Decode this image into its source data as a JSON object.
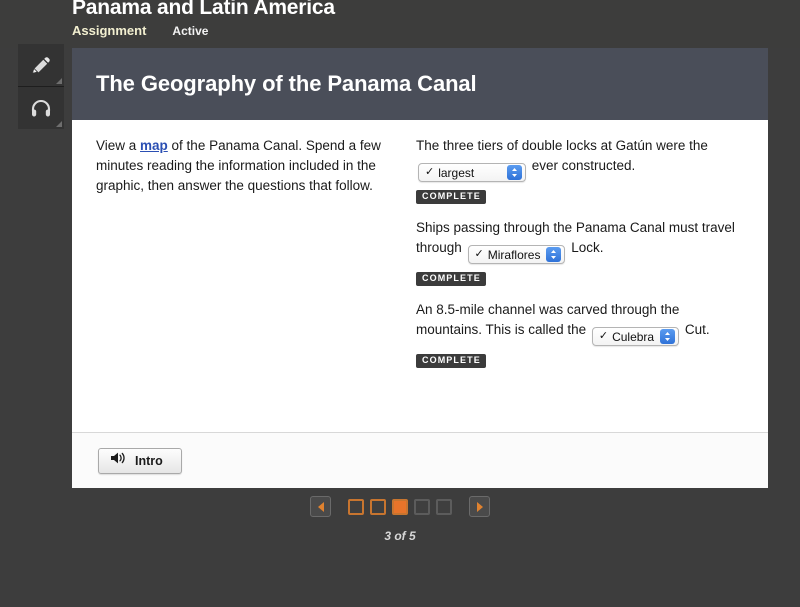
{
  "topbar": {
    "course_title": "Panama and Latin America",
    "tabs": [
      {
        "label": "Assignment",
        "state": "selected"
      },
      {
        "label": "Active",
        "state": "normal"
      }
    ]
  },
  "toolrail": {
    "items": [
      {
        "icon": "pencil-icon",
        "name": "highlighter-tool"
      },
      {
        "icon": "headphones-icon",
        "name": "audio-tool"
      }
    ]
  },
  "lesson": {
    "title": "The Geography of the Panama Canal",
    "instructions": {
      "before_link": "View a ",
      "link_text": "map",
      "after_link": " of the Panama Canal. Spend a few minutes reading the information included in the graphic, then answer the questions that follow."
    },
    "questions": [
      {
        "text_before": "The three tiers of double locks at Gatún were the ",
        "answer": "largest",
        "text_after": " ever constructed.",
        "status": "COMPLETE"
      },
      {
        "text_before": "Ships passing through the Panama Canal must travel through ",
        "answer": "Miraflores",
        "text_after": " Lock.",
        "status": "COMPLETE"
      },
      {
        "text_before": "An 8.5-mile channel was carved through the mountains. This is called the ",
        "answer": "Culebra",
        "text_after": " Cut.",
        "status": "COMPLETE"
      }
    ],
    "footer": {
      "audio_button_label": "Intro",
      "audio_button_icon": "speaker-icon"
    }
  },
  "pager": {
    "prev_icon": "triangle-left-icon",
    "next_icon": "triangle-right-icon",
    "pages": [
      {
        "state": "visited"
      },
      {
        "state": "visited"
      },
      {
        "state": "current"
      },
      {
        "state": "unvisited"
      },
      {
        "state": "unvisited"
      }
    ],
    "label": "3 of 5"
  },
  "colors": {
    "page_background": "#3d3d3d",
    "header_band": "#4a4e59",
    "accent_orange": "#e8742a",
    "link_blue": "#2b4fb3",
    "stepper_blue": "#2f72d8",
    "tab_selected": "#f2efd0"
  }
}
